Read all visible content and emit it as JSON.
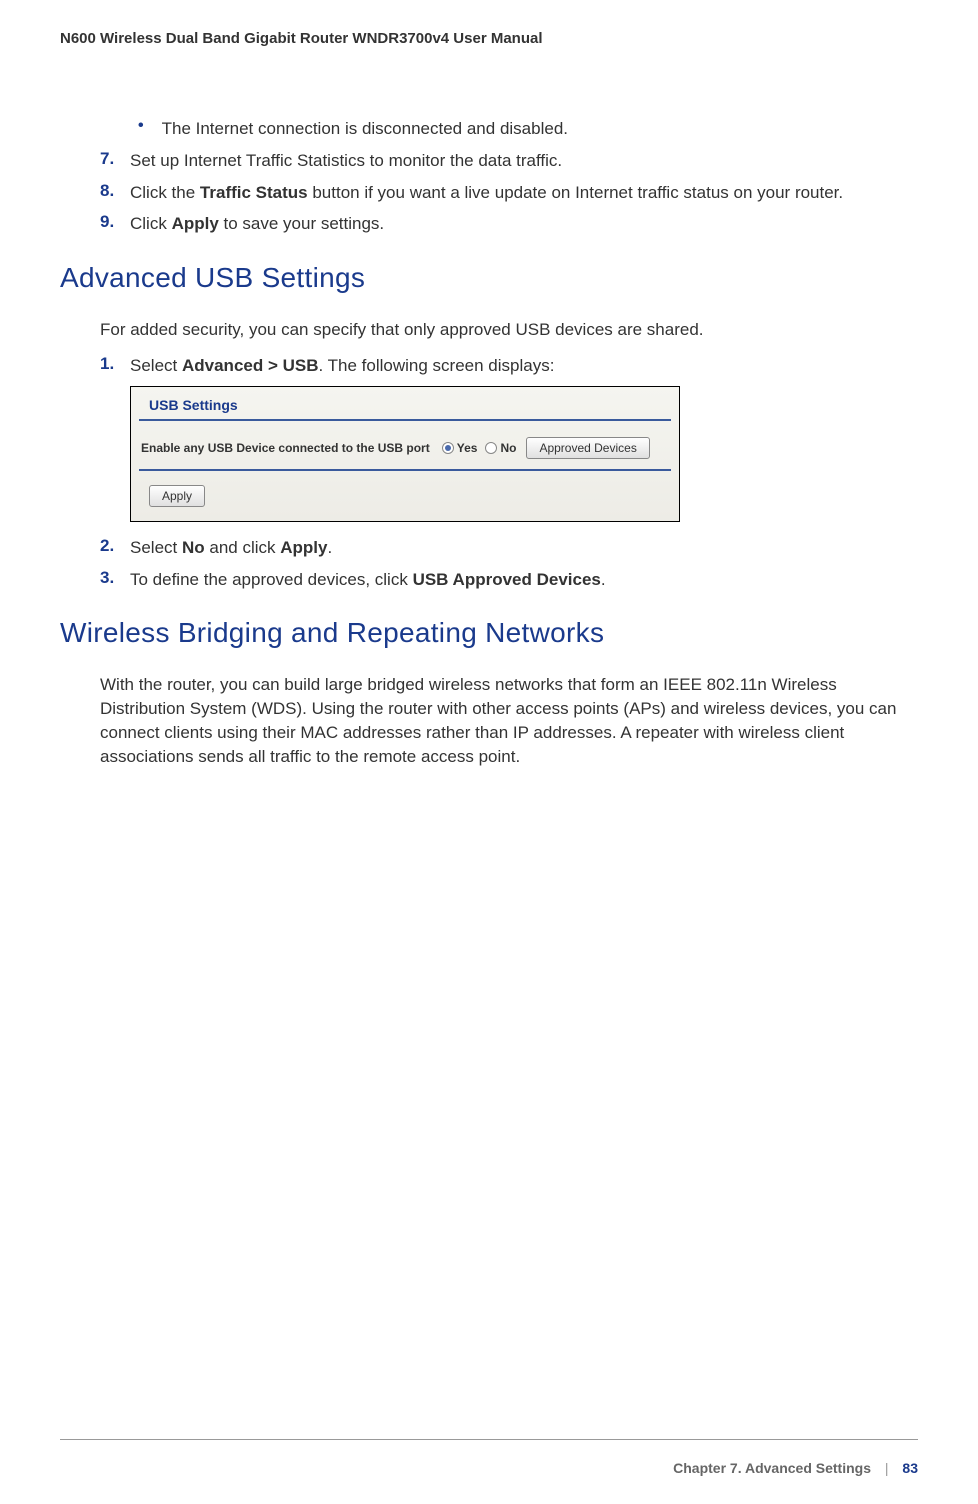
{
  "header": {
    "title": "N600 Wireless Dual Band Gigabit Router WNDR3700v4 User Manual"
  },
  "body": {
    "bullet1": "The Internet connection is disconnected and disabled.",
    "step7_num": "7.",
    "step7": "Set up Internet Traffic Statistics to monitor the data traffic.",
    "step8_num": "8.",
    "step8_a": "Click the ",
    "step8_bold": "Traffic Status",
    "step8_b": " button if you want a live update on Internet traffic status on your router.",
    "step9_num": "9.",
    "step9_a": "Click ",
    "step9_bold": "Apply",
    "step9_b": " to save your settings.",
    "section1": "Advanced USB Settings",
    "para1": "For added security, you can specify that only approved USB devices are shared.",
    "usb_step1_num": "1.",
    "usb_step1_a": "Select ",
    "usb_step1_bold": "Advanced > USB",
    "usb_step1_b": ". The following screen displays:",
    "screenshot": {
      "title": "USB Settings",
      "label": "Enable any USB Device connected to the USB port",
      "yes": "Yes",
      "no": "No",
      "approved_btn": "Approved Devices",
      "apply_btn": "Apply"
    },
    "usb_step2_num": "2.",
    "usb_step2_a": "Select ",
    "usb_step2_bold1": "No",
    "usb_step2_b": " and click ",
    "usb_step2_bold2": "Apply",
    "usb_step2_c": ".",
    "usb_step3_num": "3.",
    "usb_step3_a": "To define the approved devices, click ",
    "usb_step3_bold": "USB Approved Devices",
    "usb_step3_b": ".",
    "section2": "Wireless Bridging and Repeating Networks",
    "para2": "With the router, you can build large bridged wireless networks that form an IEEE 802.11n Wireless Distribution System (WDS). Using the router with other access points (APs) and wireless devices, you can connect clients using their MAC addresses rather than IP addresses. A repeater with wireless client associations sends all traffic to the remote access point."
  },
  "footer": {
    "chapter": "Chapter 7.  Advanced Settings",
    "pipe": "|",
    "page": "83"
  }
}
